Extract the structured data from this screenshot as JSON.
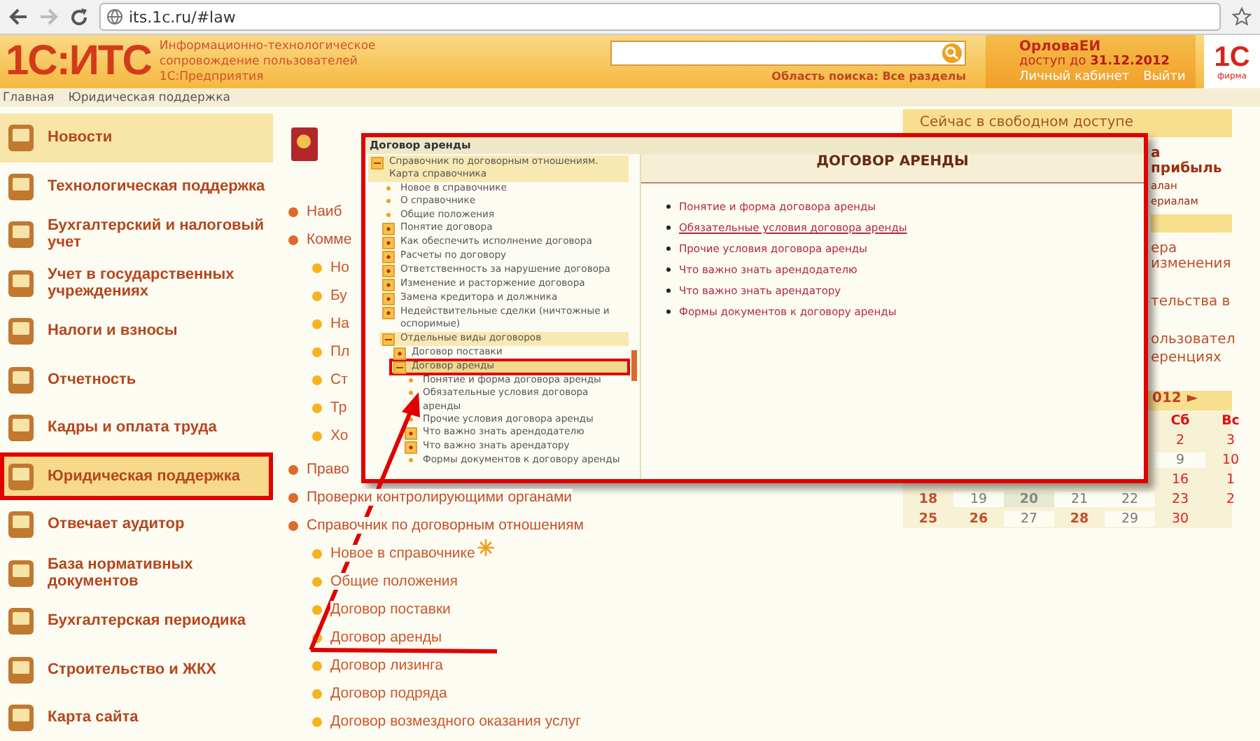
{
  "browser": {
    "url": "its.1c.ru/#law"
  },
  "header": {
    "logo": "1С:ИТС",
    "tagline": [
      "Информационно-технологическое",
      "сопровождение пользователей",
      "1С:Предприятия"
    ],
    "search_scope": "Область поиска: Все разделы",
    "user": {
      "name": "ОрловаЕИ",
      "access": "доступ до **31.12.2012**",
      "links": [
        "Личный кабинет",
        "Выйти"
      ]
    },
    "brand": {
      "logo": "1С",
      "caption": "фирма"
    }
  },
  "breadcrumbs": [
    "Главная",
    "Юридическая поддержка"
  ],
  "sidebar": {
    "items": [
      {
        "label": "Новости",
        "selected": false,
        "highlighted": true
      },
      {
        "label": "Технологическая поддержка",
        "selected": false,
        "highlighted": false
      },
      {
        "label": "Бухгалтерский и налоговый учет",
        "selected": false,
        "highlighted": false
      },
      {
        "label": "Учет в государственных учреждениях",
        "selected": false,
        "highlighted": false
      },
      {
        "label": "Налоги и взносы",
        "selected": false,
        "highlighted": false
      },
      {
        "label": "Отчетность",
        "selected": false,
        "highlighted": false
      },
      {
        "label": "Кадры и оплата труда",
        "selected": false,
        "highlighted": false
      },
      {
        "label": "Юридическая поддержка",
        "selected": true,
        "highlighted": true
      },
      {
        "label": "Отвечает аудитор",
        "selected": false,
        "highlighted": false
      },
      {
        "label": "База нормативных документов",
        "selected": false,
        "highlighted": false
      },
      {
        "label": "Бухгалтерская периодика",
        "selected": false,
        "highlighted": false
      },
      {
        "label": "Строительство и ЖКХ",
        "selected": false,
        "highlighted": false
      },
      {
        "label": "Карта сайта",
        "selected": false,
        "highlighted": false
      }
    ]
  },
  "center": {
    "tree": [
      {
        "label": "Наиб"
      },
      {
        "label": "Комме",
        "children": [
          {
            "label": "Но"
          },
          {
            "label": "Бу"
          },
          {
            "label": "На"
          },
          {
            "label": "Пл"
          },
          {
            "label": "Ст"
          },
          {
            "label": "Тр"
          },
          {
            "label": "Хо"
          }
        ]
      },
      {
        "label": "Право"
      },
      {
        "label": "Проверки контролирующими органами"
      },
      {
        "label": "Справочник по договорным отношениям",
        "children": [
          {
            "label": "Новое в справочнике",
            "new": true
          },
          {
            "label": "Общие положения"
          },
          {
            "label": "Договор поставки"
          },
          {
            "label": "Договор аренды"
          },
          {
            "label": "Договор лизинга"
          },
          {
            "label": "Договор подряда"
          },
          {
            "label": "Договор возмездного оказания услуг"
          }
        ]
      }
    ]
  },
  "right": {
    "title": "Сейчас в свободном доступе",
    "sections": [
      {
        "lines": [
          {
            "text": "а прибыль",
            "kind": "heading"
          },
          {
            "text": "алан",
            "kind": "link"
          },
          {
            "text": "ериалам",
            "kind": "link"
          }
        ]
      },
      {
        "lines": [
          {
            "text": "ера изменения",
            "kind": "item"
          },
          {
            "text": "тельства в",
            "kind": "item"
          },
          {
            "text": "ользовател",
            "kind": "item"
          },
          {
            "text": "еренциях",
            "kind": "cont"
          }
        ]
      }
    ],
    "calendar": {
      "title": "012",
      "next": "►",
      "weekdays": {
        "right_aligned": true,
        "cells": [
          "Сб",
          "Вс"
        ]
      },
      "rows": [
        {
          "right_aligned": true,
          "cells": [
            {
              "text": "2",
              "kind": "weekend"
            },
            {
              "text": "3",
              "kind": "weekend"
            }
          ]
        },
        {
          "right_aligned": true,
          "cells": [
            {
              "text": "9",
              "kind": "plain"
            },
            {
              "text": "10",
              "kind": "weekend"
            }
          ]
        },
        {
          "right_aligned": true,
          "cells": [
            {
              "text": "16",
              "kind": "weekend"
            },
            {
              "text": "1",
              "kind": "weekend"
            }
          ]
        },
        {
          "cells": [
            {
              "text": "18",
              "kind": "link"
            },
            {
              "text": "19",
              "kind": "plain"
            },
            {
              "text": "20",
              "kind": "today"
            },
            {
              "text": "21",
              "kind": "plain"
            },
            {
              "text": "22",
              "kind": "plain"
            },
            {
              "text": "23",
              "kind": "weekend"
            },
            {
              "text": "2",
              "kind": "weekend"
            }
          ]
        },
        {
          "right_aligned": false,
          "cells": [
            {
              "text": "25",
              "kind": "link"
            },
            {
              "text": "26",
              "kind": "link"
            },
            {
              "text": "27",
              "kind": "plain"
            },
            {
              "text": "28",
              "kind": "link"
            },
            {
              "text": "29",
              "kind": "plain"
            },
            {
              "text": "30",
              "kind": "weekend"
            }
          ]
        }
      ]
    }
  },
  "popup": {
    "title": "Договор аренды",
    "tree": [
      {
        "label": "Справочник по договорным отношениям. Карта справочника",
        "kind": "folder",
        "expanded": true,
        "selected": false,
        "children": [
          {
            "label": "Новое в справочнике",
            "kind": "page",
            "selected": false
          },
          {
            "label": "О справочнике",
            "kind": "page",
            "selected": false
          },
          {
            "label": "Общие положения",
            "kind": "page",
            "selected": false
          },
          {
            "label": "Понятие договора",
            "kind": "folder",
            "expanded": false,
            "selected": false
          },
          {
            "label": "Как обеспечить исполнение договора",
            "kind": "folder",
            "expanded": false,
            "selected": false
          },
          {
            "label": "Расчеты по договору",
            "kind": "folder",
            "expanded": false,
            "selected": false
          },
          {
            "label": "Ответственность за нарушение договора",
            "kind": "folder",
            "expanded": false,
            "selected": false
          },
          {
            "label": "Изменение и расторжение договора",
            "kind": "folder",
            "expanded": false,
            "selected": false
          },
          {
            "label": "Замена кредитора и должника",
            "kind": "folder",
            "expanded": false,
            "selected": false
          },
          {
            "label": "Недействительные сделки (ничтожные и оспоримые)",
            "kind": "folder",
            "expanded": false,
            "selected": false
          },
          {
            "label": "Отдельные виды договоров",
            "kind": "folder",
            "expanded": true,
            "selected": false,
            "children": [
              {
                "label": "Договор поставки",
                "kind": "folder",
                "expanded": false,
                "selected": false
              },
              {
                "label": "Договор аренды",
                "kind": "folder",
                "expanded": true,
                "selected": true,
                "children": [
                  {
                    "label": "Понятие и форма договора аренды",
                    "kind": "page",
                    "selected": false
                  },
                  {
                    "label": "Обязательные условия договора аренды",
                    "kind": "page",
                    "selected": false
                  },
                  {
                    "label": "Прочие условия договора аренды",
                    "kind": "page",
                    "selected": false
                  },
                  {
                    "label": "Что важно знать арендодателю",
                    "kind": "folder",
                    "expanded": false,
                    "selected": false
                  },
                  {
                    "label": "Что важно знать арендатору",
                    "kind": "folder",
                    "expanded": false,
                    "selected": false
                  },
                  {
                    "label": "Формы документов к договору аренды",
                    "kind": "page",
                    "selected": false
                  }
                ]
              }
            ]
          }
        ]
      }
    ],
    "heading": "ДОГОВОР АРЕНДЫ",
    "links": [
      {
        "text": "Понятие и форма договора аренды",
        "hovered": false
      },
      {
        "text": "Обязательные условия договора аренды",
        "hovered": true
      },
      {
        "text": "Прочие условия договора аренды",
        "hovered": false
      },
      {
        "text": "Что важно знать арендодателю",
        "hovered": false
      },
      {
        "text": "Что важно знать арендатору",
        "hovered": false
      },
      {
        "text": "Формы документов к договору аренды",
        "hovered": false
      }
    ]
  }
}
